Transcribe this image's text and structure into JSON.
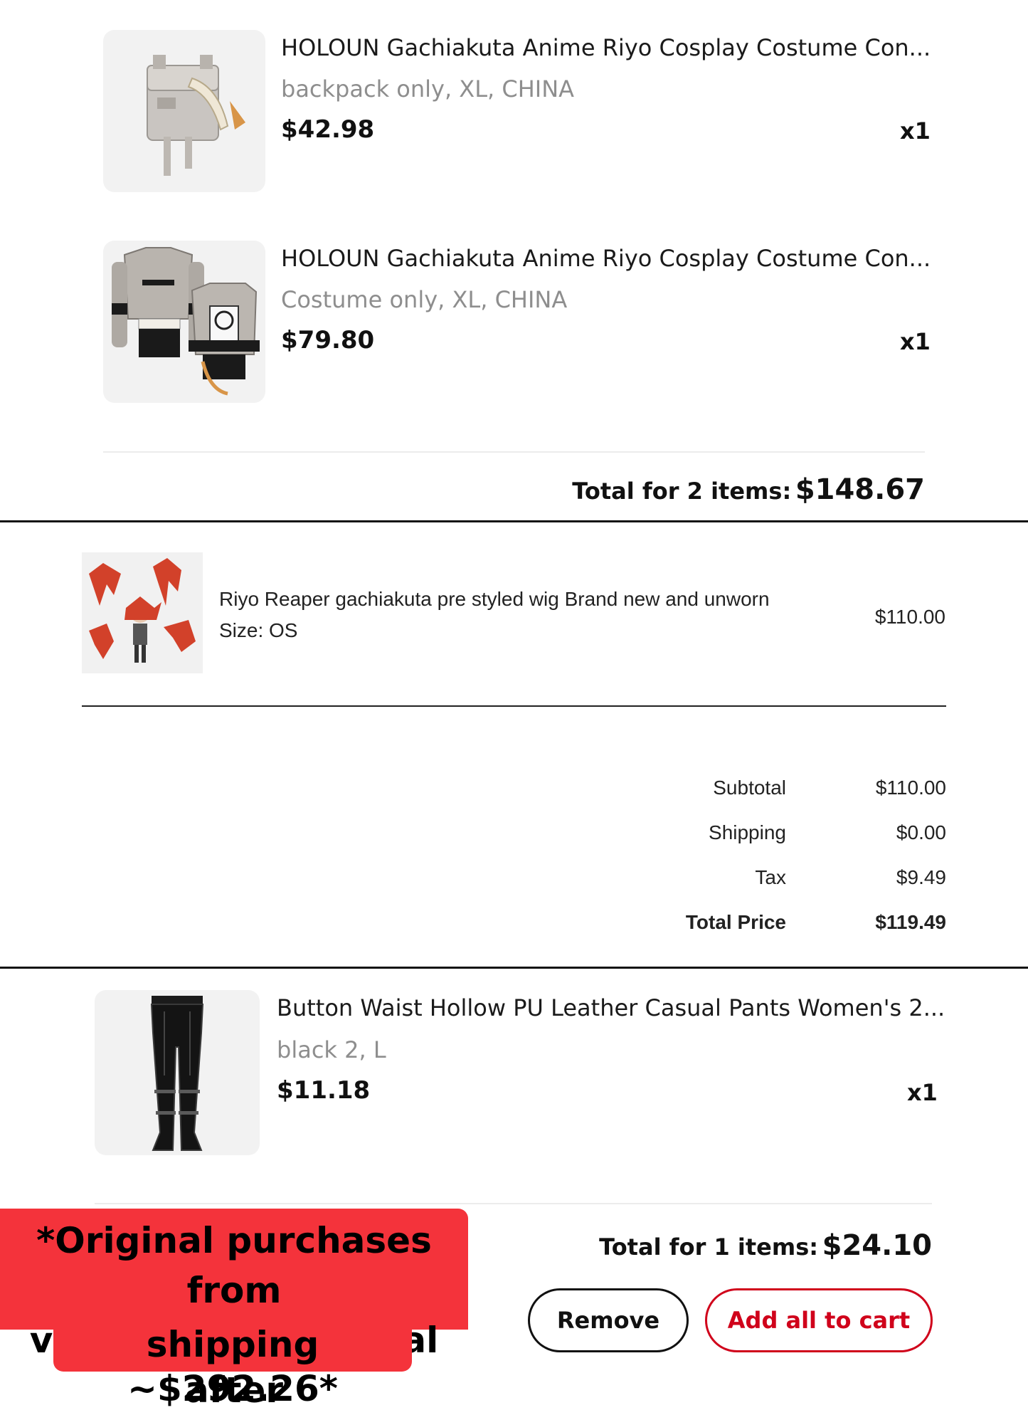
{
  "shop_order_1": {
    "items": [
      {
        "title": "HOLOUN Gachiakuta Anime Riyo Cosplay Costume Con...",
        "variant": "backpack only, XL, CHINA",
        "price": "$42.98",
        "qty": "x1",
        "image_icon": "backpack-image"
      },
      {
        "title": "HOLOUN Gachiakuta Anime Riyo Cosplay Costume Con...",
        "variant": "Costume only, XL, CHINA",
        "price": "$79.80",
        "qty": "x1",
        "image_icon": "costume-image"
      }
    ],
    "total_label": "Total for 2 items:",
    "total_value": "$148.67"
  },
  "shop_order_2": {
    "item": {
      "title": "Riyo Reaper gachiakuta pre styled wig Brand new and unworn",
      "size": "Size: OS",
      "price": "$110.00",
      "image_icon": "wig-image"
    },
    "summary": [
      {
        "label": "Subtotal",
        "value": "$110.00",
        "bold": false
      },
      {
        "label": "Shipping",
        "value": "$0.00",
        "bold": false
      },
      {
        "label": "Tax",
        "value": "$9.49",
        "bold": false
      },
      {
        "label": "Total Price",
        "value": "$119.49",
        "bold": true
      }
    ]
  },
  "shop_order_3": {
    "item": {
      "title": "Button Waist Hollow PU Leather Casual Pants Women's 2...",
      "variant": "black 2, L",
      "price": "$11.18",
      "qty": "x1",
      "image_icon": "pants-image"
    },
    "total_label": "Total for 1 items:",
    "total_value": "$24.10",
    "remove_label": "Remove",
    "add_all_label": "Add all to cart"
  },
  "notice": {
    "line1": "*Original purchases from",
    "line2": "various stores. Total after",
    "line3": "shipping ~$292.26*"
  },
  "colors": {
    "accent_red": "#d0021b",
    "notice_bg": "#f4333b"
  }
}
